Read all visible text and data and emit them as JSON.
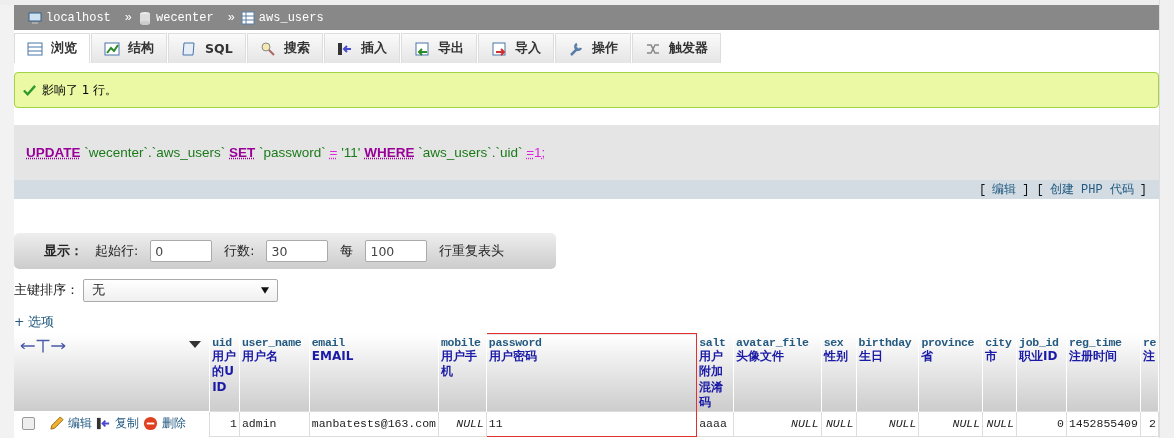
{
  "breadcrumb": [
    {
      "label": "localhost",
      "kind": "server"
    },
    {
      "label": "wecenter",
      "kind": "database"
    },
    {
      "label": "aws_users",
      "kind": "table"
    }
  ],
  "breadcrumb_separator": "»",
  "tabs": [
    {
      "label": "浏览",
      "selected": true
    },
    {
      "label": "结构",
      "selected": false
    },
    {
      "label": "SQL",
      "selected": false
    },
    {
      "label": "搜索",
      "selected": false
    },
    {
      "label": "插入",
      "selected": false
    },
    {
      "label": "导出",
      "selected": false
    },
    {
      "label": "导入",
      "selected": false
    },
    {
      "label": "操作",
      "selected": false
    },
    {
      "label": "触发器",
      "selected": false
    }
  ],
  "message": "影响了 1 行。",
  "sql": [
    {
      "text": "UPDATE",
      "kind": "keyword"
    },
    {
      "text": " `wecenter`.`aws_users` ",
      "kind": "ident"
    },
    {
      "text": "SET",
      "kind": "keyword"
    },
    {
      "text": " `password` ",
      "kind": "ident"
    },
    {
      "text": "=",
      "kind": "op"
    },
    {
      "text": " '11' ",
      "kind": "string"
    },
    {
      "text": "WHERE",
      "kind": "keyword"
    },
    {
      "text": " `aws_users`.`uid` ",
      "kind": "ident"
    },
    {
      "text": "=",
      "kind": "op"
    },
    {
      "text": "1",
      "kind": "number"
    },
    {
      "text": ";",
      "kind": "punct"
    }
  ],
  "sql_links": {
    "open": "[",
    "edit": "编辑",
    "mid": "] [",
    "php": "创建 PHP 代码",
    "close": "]"
  },
  "display": {
    "label": "显示：",
    "start_label": "起始行:",
    "start": "0",
    "rows_label": "行数:",
    "rows": "30",
    "every_label": "每",
    "every": "100",
    "repeat_label": "行重复表头"
  },
  "sort": {
    "label": "主键排序：",
    "value": "无"
  },
  "options": "+ 选项",
  "columns": [
    {
      "name": "uid",
      "comment": "用户的UID",
      "highlighted": false
    },
    {
      "name": "user_name",
      "comment": "用户名",
      "highlighted": false
    },
    {
      "name": "email",
      "comment": "EMAIL",
      "highlighted": false
    },
    {
      "name": "mobile",
      "comment": "用户手机",
      "highlighted": false
    },
    {
      "name": "password",
      "comment": "用户密码",
      "highlighted": true
    },
    {
      "name": "salt",
      "comment": "用户附加混淆码",
      "highlighted": false
    },
    {
      "name": "avatar_file",
      "comment": "头像文件",
      "highlighted": false
    },
    {
      "name": "sex",
      "comment": "性别",
      "highlighted": false
    },
    {
      "name": "birthday",
      "comment": "生日",
      "highlighted": false
    },
    {
      "name": "province",
      "comment": "省",
      "highlighted": false
    },
    {
      "name": "city",
      "comment": "市",
      "highlighted": false
    },
    {
      "name": "job_id",
      "comment": "职业ID",
      "highlighted": false
    },
    {
      "name": "reg_time",
      "comment": "注册时间",
      "highlighted": false
    },
    {
      "name": "re",
      "comment": "注",
      "highlighted": false
    }
  ],
  "rows": [
    {
      "checked": false,
      "actions": [
        "编辑",
        "复制",
        "删除"
      ],
      "cells": [
        {
          "text": "1",
          "kind": "number"
        },
        {
          "text": "admin",
          "kind": "text"
        },
        {
          "text": "manbatests@163.com",
          "kind": "text"
        },
        {
          "text": "NULL",
          "kind": "null"
        },
        {
          "text": "11",
          "kind": "text"
        },
        {
          "text": "aaaa",
          "kind": "text"
        },
        {
          "text": "NULL",
          "kind": "null"
        },
        {
          "text": "NULL",
          "kind": "null"
        },
        {
          "text": "NULL",
          "kind": "null"
        },
        {
          "text": "NULL",
          "kind": "null"
        },
        {
          "text": "NULL",
          "kind": "null"
        },
        {
          "text": "0",
          "kind": "number"
        },
        {
          "text": "1452855409",
          "kind": "number"
        },
        {
          "text": "2",
          "kind": "number"
        }
      ]
    }
  ]
}
